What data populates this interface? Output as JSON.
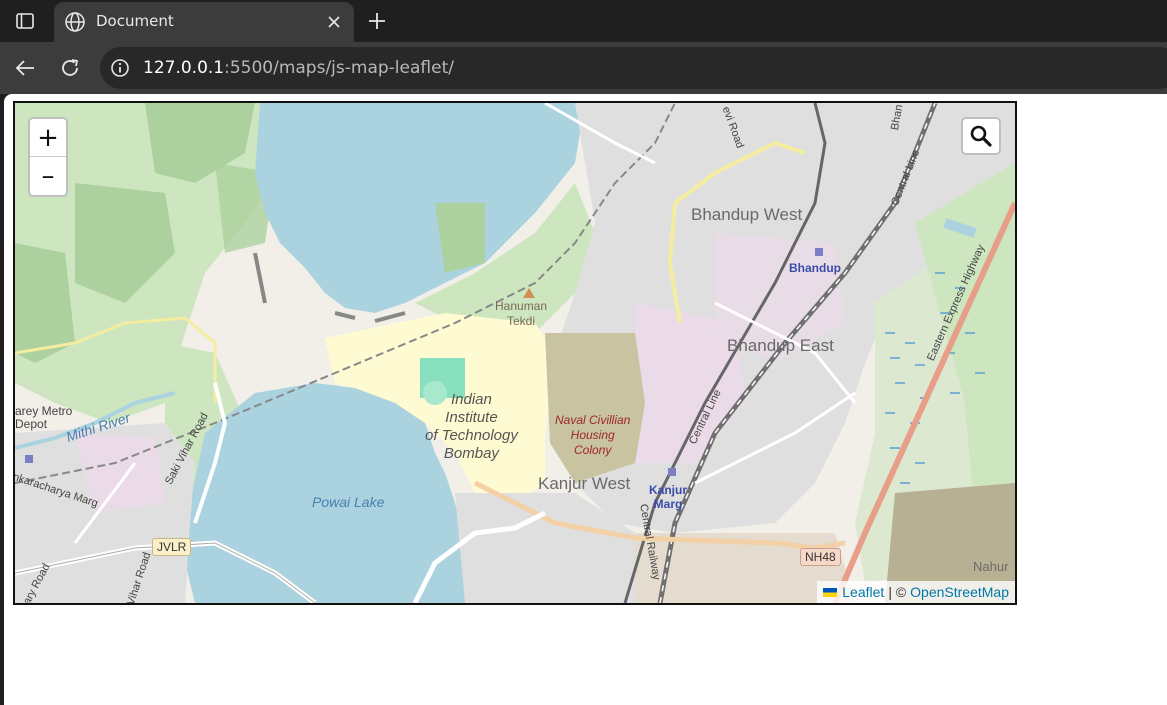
{
  "browser": {
    "tab": {
      "title": "Document"
    },
    "url": {
      "host": "127.0.0.1",
      "path": ":5500/maps/js-map-leaflet/"
    }
  },
  "map": {
    "zoom_in": "+",
    "zoom_out": "–",
    "labels": {
      "bhandup_west": "Bhandup West",
      "bhandup_east": "Bhandup East",
      "bhandup_station": "Bhandup",
      "hanuman_tekdi": "Hanuman\nTekdi",
      "iit": "Indian\nInstitute\nof Technology\nBombay",
      "naval_colony": "Naval Civillian\nHousing\nColony",
      "kanjur_west": "Kanjur West",
      "kanjur_marg": "Kanjur\nMarg",
      "powai_lake": "Powai Lake",
      "mithi_river": "Mithi River",
      "metro_depot": "arey Metro\nDepot",
      "saki_vihar_road": "Saki Vihar Road",
      "shankaracharya_marg": "nkaracharya Marg",
      "central_line_1": "Central Line",
      "central_line_2": "Central Line",
      "central_railway": "Central Railway",
      "eastern_express_highway": "Eastern Express Highway",
      "vihar_road": "Vihar Road",
      "road_bl": "ary Road",
      "nh48": "NH48",
      "jvlr": "JVLR",
      "road_top": "evi Road",
      "road_top2": "Bhan",
      "nahur": "Nahur"
    },
    "attribution": {
      "leaflet": "Leaflet",
      "sep": "| ©",
      "osm": "OpenStreetMap"
    }
  },
  "colors": {
    "water": "#aad3df",
    "forest": "#add19e",
    "campus": "#fefbd2",
    "residential": "#e0dfdf",
    "industrial": "#ebdbe8",
    "motorway": "#e892a2"
  }
}
